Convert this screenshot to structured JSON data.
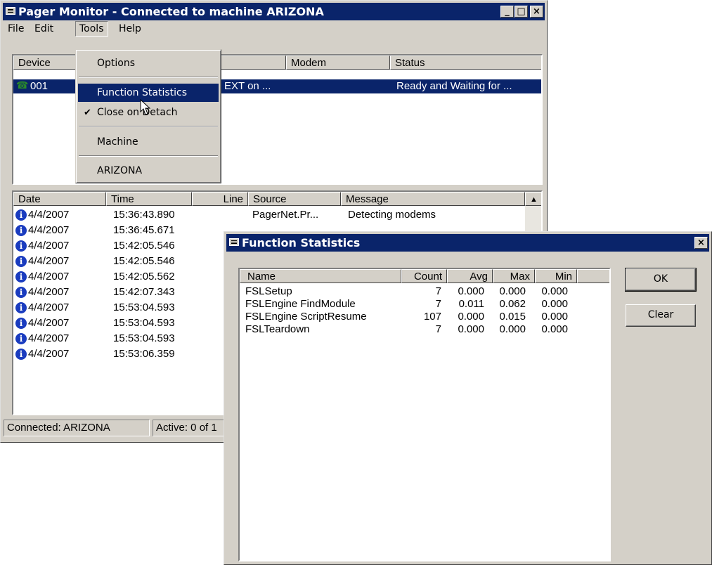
{
  "pager": {
    "title": "Pager Monitor - Connected to machine ARIZONA",
    "menu": [
      "File",
      "Edit",
      "Tools",
      "Help"
    ],
    "device_headers": [
      "Device",
      "Modem",
      "Status"
    ],
    "device_row": {
      "device": "001",
      "modem_partial": "EXT on ...",
      "status": "Ready and Waiting for ..."
    },
    "log_headers": [
      "Date",
      "Time",
      "Line",
      "Source",
      "Message"
    ],
    "log_rows": [
      {
        "date": "4/4/2007",
        "time": "15:36:43.890",
        "source": "PagerNet.Pr...",
        "message": "Detecting modems"
      },
      {
        "date": "4/4/2007",
        "time": "15:36:45.671"
      },
      {
        "date": "4/4/2007",
        "time": "15:42:05.546"
      },
      {
        "date": "4/4/2007",
        "time": "15:42:05.546"
      },
      {
        "date": "4/4/2007",
        "time": "15:42:05.562"
      },
      {
        "date": "4/4/2007",
        "time": "15:42:07.343"
      },
      {
        "date": "4/4/2007",
        "time": "15:53:04.593"
      },
      {
        "date": "4/4/2007",
        "time": "15:53:04.593"
      },
      {
        "date": "4/4/2007",
        "time": "15:53:04.593"
      },
      {
        "date": "4/4/2007",
        "time": "15:53:06.359"
      }
    ],
    "status_connected": "Connected: ARIZONA",
    "status_active": "Active: 0 of 1"
  },
  "tools_menu": {
    "items": [
      "Options",
      "Function Statistics",
      "Close on Detach",
      "Machine",
      "ARIZONA"
    ],
    "selected": "Function Statistics",
    "checked": "Close on Detach"
  },
  "stats_dialog": {
    "title": "Function Statistics",
    "headers": [
      "Name",
      "Count",
      "Avg",
      "Max",
      "Min"
    ],
    "rows": [
      {
        "name": "FSLSetup",
        "count": "7",
        "avg": "0.000",
        "max": "0.000",
        "min": "0.000"
      },
      {
        "name": "FSLEngine FindModule",
        "count": "7",
        "avg": "0.011",
        "max": "0.062",
        "min": "0.000"
      },
      {
        "name": "FSLEngine ScriptResume",
        "count": "107",
        "avg": "0.000",
        "max": "0.015",
        "min": "0.000"
      },
      {
        "name": "FSLTeardown",
        "count": "7",
        "avg": "0.000",
        "max": "0.000",
        "min": "0.000"
      }
    ],
    "ok_label": "OK",
    "clear_label": "Clear"
  },
  "colors": {
    "titlebar": "#0a246a",
    "face": "#d4d0c8",
    "info_icon": "#1a3cbf"
  }
}
